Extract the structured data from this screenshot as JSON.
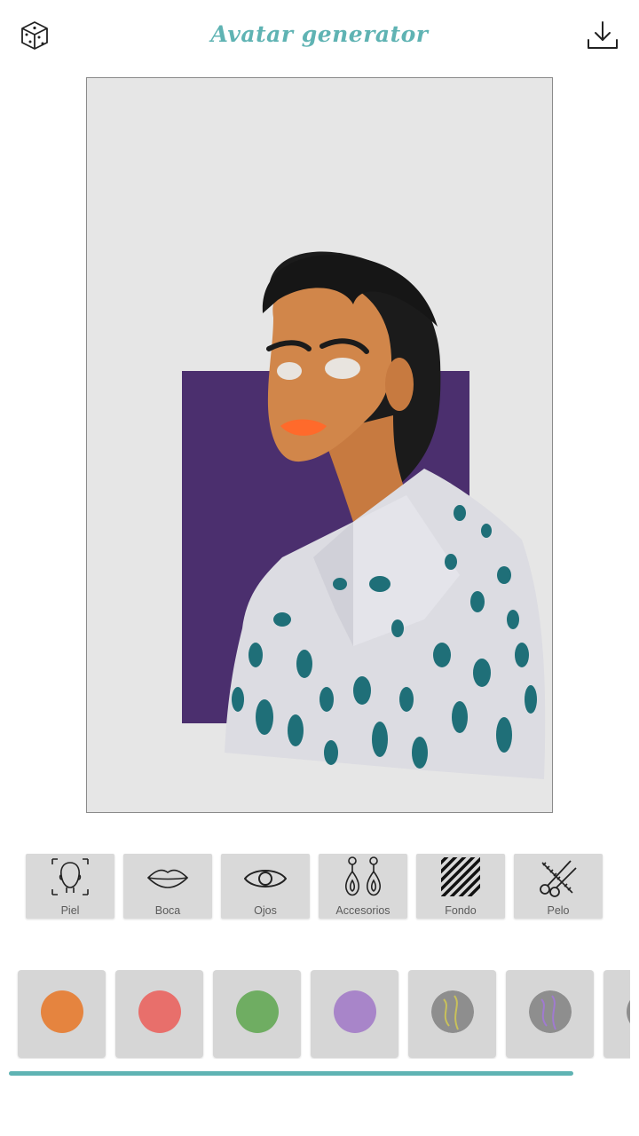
{
  "header": {
    "title": "Avatar generator",
    "random_icon": "dice-icon",
    "download_icon": "download-icon"
  },
  "avatar": {
    "background_color": "#e6e6e6",
    "accent_block_color": "#4b2f6e",
    "skin_color": "#d1864a",
    "hair_color": "#1b1b1b",
    "lips_color": "#ff6a2b",
    "shirt_color": "#dcdce2",
    "pattern_color": "#1f6f78"
  },
  "categories": [
    {
      "label": "Piel",
      "icon": "face-icon"
    },
    {
      "label": "Boca",
      "icon": "lips-icon"
    },
    {
      "label": "Ojos",
      "icon": "eye-icon"
    },
    {
      "label": "Accesorios",
      "icon": "earrings-icon"
    },
    {
      "label": "Fondo",
      "icon": "stripes-icon"
    },
    {
      "label": "Pelo",
      "icon": "scissors-comb-icon"
    }
  ],
  "swatches": [
    {
      "color": "#e5843f",
      "type": "solid"
    },
    {
      "color": "#e86f6b",
      "type": "solid"
    },
    {
      "color": "#6fad62",
      "type": "solid"
    },
    {
      "color": "#a885c9",
      "type": "solid"
    },
    {
      "color": "#8e8e8e",
      "type": "pattern",
      "accent": "#c9c15a"
    },
    {
      "color": "#8e8e8e",
      "type": "pattern",
      "accent": "#a07ad0"
    },
    {
      "color": "#8e8e8e",
      "type": "partial"
    }
  ]
}
